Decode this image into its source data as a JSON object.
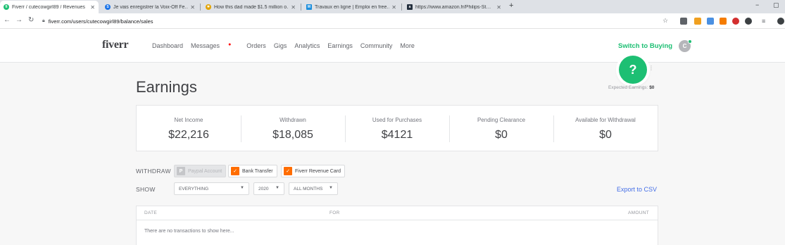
{
  "browser": {
    "tabs": [
      {
        "title": "Fiverr / cutecowgirl89 / Revenues",
        "favicon": "fiverr-favicon",
        "color": "#1dbf73",
        "glyph": "fi"
      },
      {
        "title": "Je vais enregistrer la Voix-Off Fe…",
        "favicon": "fiverr-favicon",
        "color": "#1a73e8",
        "glyph": "S"
      },
      {
        "title": "How this dad made $1.5 million o…",
        "favicon": "nbc-peacock-icon",
        "color": "#e2a300",
        "glyph": "✱"
      },
      {
        "title": "Travaux en ligne | Emploi en free…",
        "favicon": "malt-favicon",
        "color": "#1d8fdd",
        "glyph": "M"
      },
      {
        "title": "https://www.amazon.fr/Philips-St…",
        "favicon": "amazon-favicon",
        "color": "#232f3e",
        "glyph": "a"
      }
    ],
    "url": "fiverr.com/users/cutecowgirl89/balance/sales"
  },
  "header": {
    "logo": "fiverr",
    "nav": [
      "Dashboard",
      "Messages",
      "Orders",
      "Gigs",
      "Analytics",
      "Earnings",
      "Community",
      "More"
    ],
    "switch_label": "Switch to Buying",
    "avatar_initial": "C"
  },
  "page": {
    "title": "Earnings",
    "help_glyph": "?",
    "expected_label": "Expected Earnings:",
    "expected_value": "$0"
  },
  "stats": [
    {
      "label": "Net Income",
      "value": "$22,216"
    },
    {
      "label": "Withdrawn",
      "value": "$18,085"
    },
    {
      "label": "Used for Purchases",
      "value": "$4121"
    },
    {
      "label": "Pending Clearance",
      "value": "$0"
    },
    {
      "label": "Available for Withdrawal",
      "value": "$0"
    }
  ],
  "withdraw": {
    "label": "WITHDRAW",
    "options": [
      "Paypal Account",
      "Bank Transfer",
      "Fiverr Revenue Card"
    ]
  },
  "show": {
    "label": "SHOW",
    "type_value": "EVERYTHING",
    "year_value": "2020",
    "month_value": "ALL MONTHS"
  },
  "export_label": "Export to CSV",
  "table": {
    "columns": [
      "DATE",
      "FOR",
      "AMOUNT"
    ],
    "empty_message": "There are no transactions to show here..."
  },
  "colors": {
    "accent": "#1dbf73",
    "link": "#446ee7",
    "card_orange": "#ff6d00"
  }
}
